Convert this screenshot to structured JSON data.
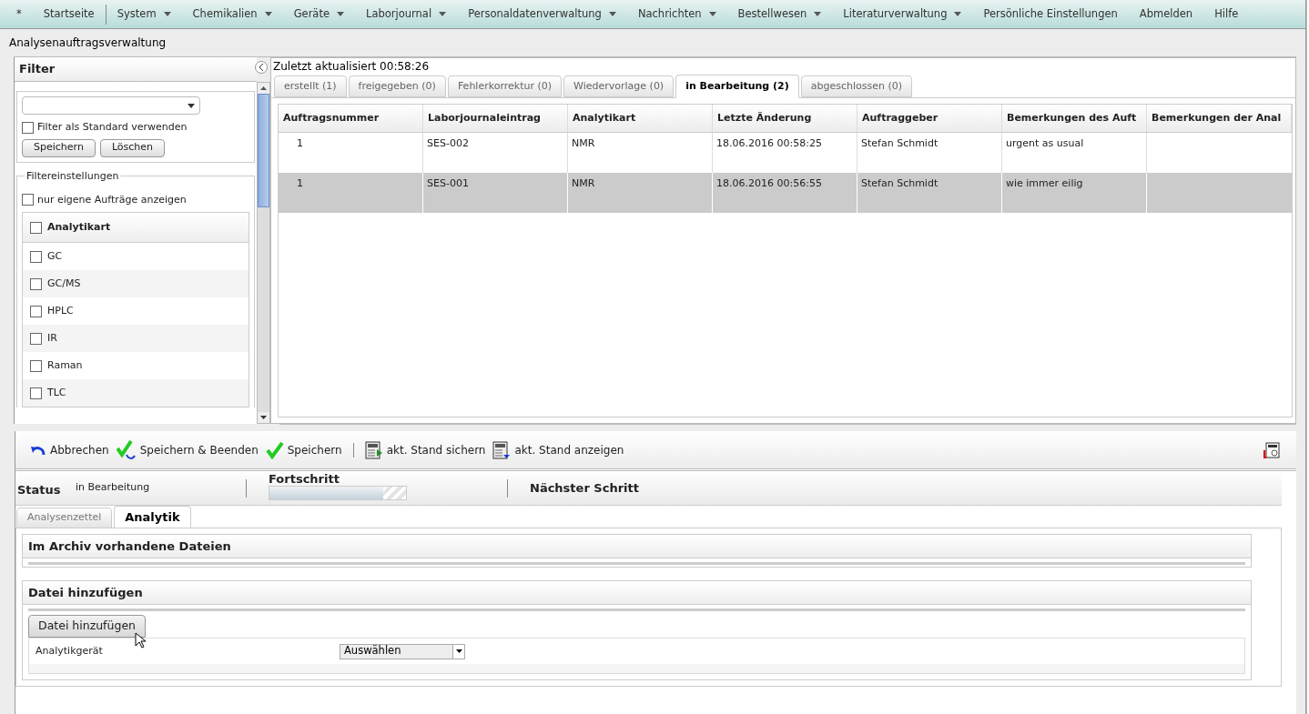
{
  "menu": [
    {
      "label": "*",
      "dropdown": false
    },
    {
      "label": "Startseite",
      "dropdown": false
    },
    {
      "label": "System",
      "dropdown": true
    },
    {
      "label": "Chemikalien",
      "dropdown": true
    },
    {
      "label": "Geräte",
      "dropdown": true
    },
    {
      "label": "Laborjournal",
      "dropdown": true
    },
    {
      "label": "Personaldatenverwaltung",
      "dropdown": true
    },
    {
      "label": "Nachrichten",
      "dropdown": true
    },
    {
      "label": "Bestellwesen",
      "dropdown": true
    },
    {
      "label": "Literaturverwaltung",
      "dropdown": true
    },
    {
      "label": "Persönliche Einstellungen",
      "dropdown": false
    },
    {
      "label": "Abmelden",
      "dropdown": false
    },
    {
      "label": "Hilfe",
      "dropdown": false
    }
  ],
  "page_title": "Analysenauftragsverwaltung",
  "filter": {
    "title": "Filter",
    "default_checkbox": {
      "label": "Filter als Standard verwenden",
      "checked": false
    },
    "buttons": [
      "Speichern",
      "Löschen"
    ],
    "settings_title": "Filtereinstellungen",
    "own_only": {
      "label": "nur eigene Aufträge anzeigen",
      "checked": false
    },
    "analytics_header": {
      "label": "Analytikart",
      "checked": false
    },
    "analytics": [
      {
        "label": "GC",
        "checked": false
      },
      {
        "label": "GC/MS",
        "checked": false
      },
      {
        "label": "HPLC",
        "checked": false
      },
      {
        "label": "IR",
        "checked": false
      },
      {
        "label": "Raman",
        "checked": false
      },
      {
        "label": "TLC",
        "checked": false
      }
    ]
  },
  "updated": "Zuletzt aktualisiert 00:58:26",
  "tabs": [
    {
      "label": "erstellt (1)",
      "selected": false
    },
    {
      "label": "freigegeben (0)",
      "selected": false
    },
    {
      "label": "Fehlerkorrektur (0)",
      "selected": false
    },
    {
      "label": "Wiedervorlage (0)",
      "selected": false
    },
    {
      "label": "in Bearbeitung (2)",
      "selected": true
    },
    {
      "label": "abgeschlossen (0)",
      "selected": false
    }
  ],
  "table": {
    "columns": [
      "Auftragsnummer",
      "Laborjournaleintrag",
      "Analytikart",
      "Letzte Änderung",
      "Auftraggeber",
      "Bemerkungen des Auft",
      "Bemerkungen der Anal"
    ],
    "rows": [
      {
        "selected": false,
        "cells": [
          "1",
          "SES-002",
          "NMR",
          "18.06.2016 00:58:25",
          "Stefan Schmidt",
          "urgent as usual"
        ]
      },
      {
        "selected": true,
        "cells": [
          "1",
          "SES-001",
          "NMR",
          "18.06.2016 00:56:55",
          "Stefan Schmidt",
          "wie immer eilig"
        ]
      }
    ]
  },
  "toolbar": [
    {
      "label": "Abbrechen",
      "kind": "undo"
    },
    {
      "label": "Speichern & Beenden",
      "kind": "check-cycle"
    },
    {
      "label": "Speichern",
      "kind": "check"
    },
    {
      "label": "akt. Stand sichern",
      "kind": "pdf-save"
    },
    {
      "label": "akt. Stand anzeigen",
      "kind": "pdf-show"
    }
  ],
  "status": {
    "label": "Status",
    "value": "in Bearbeitung",
    "progress_label": "Fortschritt",
    "level": 0.83,
    "next_label": "Nächster Schritt"
  },
  "detail_tabs": [
    {
      "label": "Analysenzettel",
      "selected": false
    },
    {
      "label": "Analytik",
      "selected": true
    }
  ],
  "archive_title": "Im Archiv vorhandene Dateien",
  "add_section": {
    "title": "Datei hinzufügen",
    "button": "Datei hinzufügen",
    "device_label": "Analytikgerät",
    "device_value": "Auswählen"
  }
}
